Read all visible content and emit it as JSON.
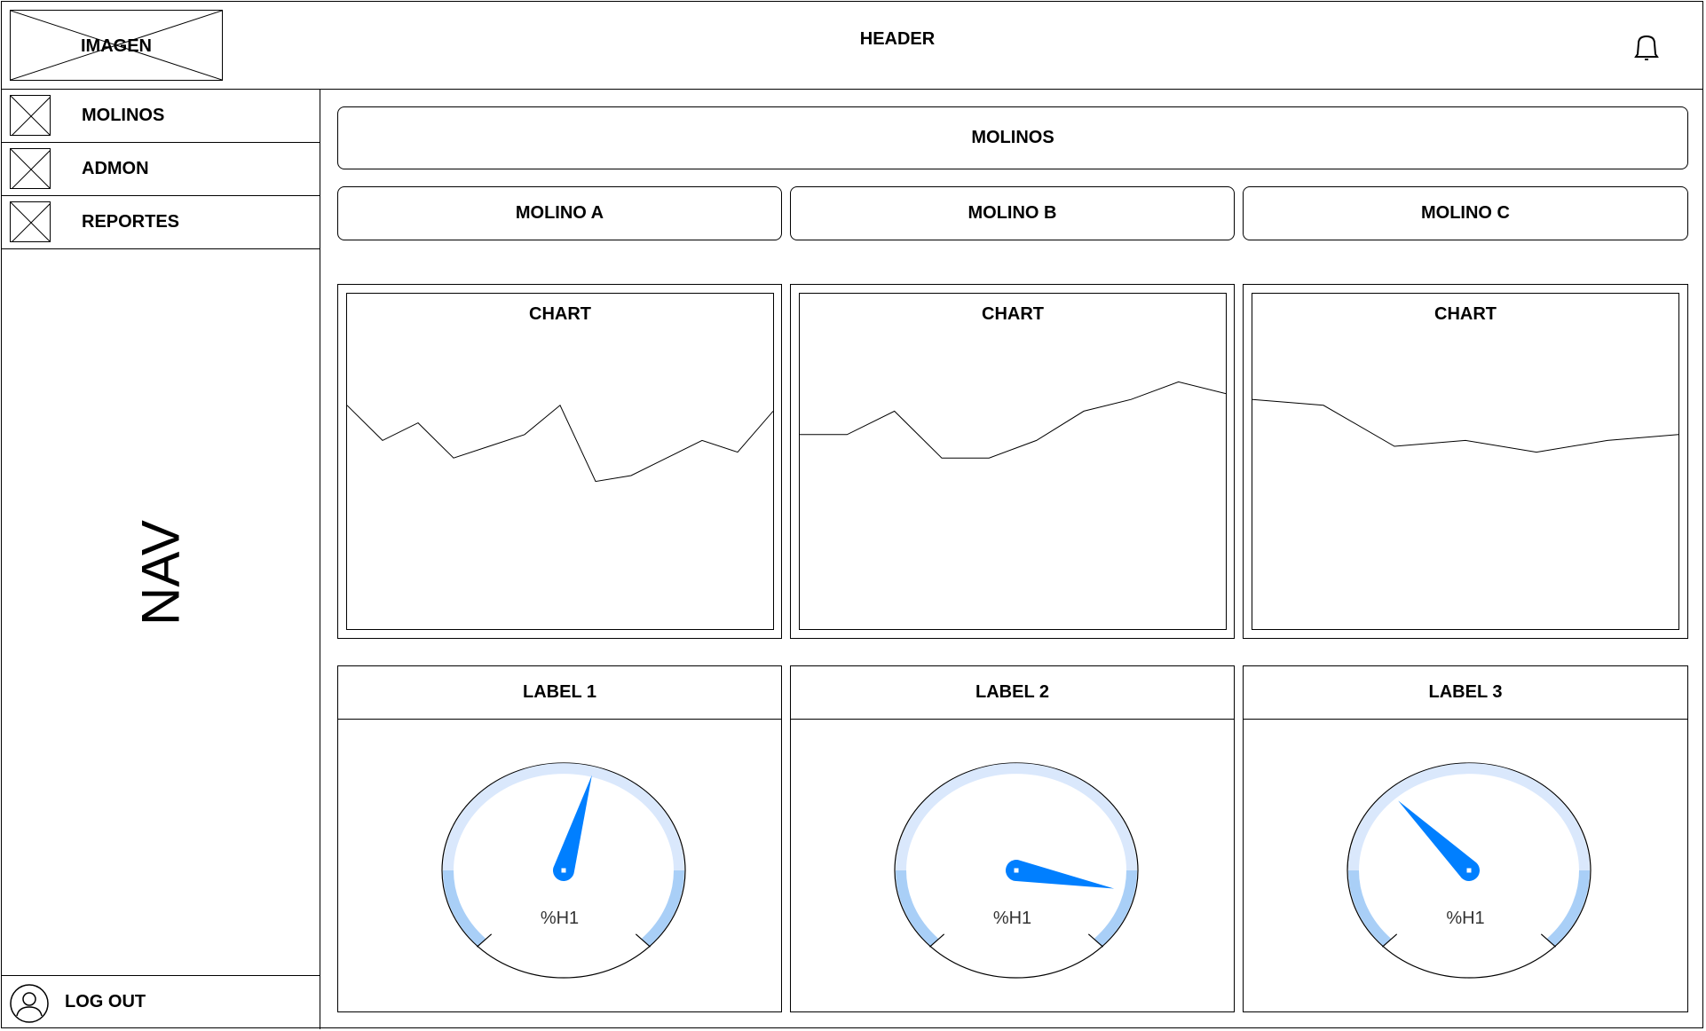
{
  "header": {
    "logo_label": "IMAGEN",
    "title": "HEADER",
    "notification_icon": "bell-icon"
  },
  "nav": {
    "items": [
      {
        "label": "MOLINOS",
        "icon": "image-placeholder-icon"
      },
      {
        "label": "ADMON",
        "icon": "image-placeholder-icon"
      },
      {
        "label": "REPORTES",
        "icon": "image-placeholder-icon"
      }
    ],
    "title": "NAV",
    "logout": {
      "label": "LOG OUT",
      "icon": "user-icon"
    }
  },
  "main": {
    "section_button": "MOLINOS",
    "mill_buttons": [
      "MOLINO A",
      "MOLINO B",
      "MOLINO C"
    ],
    "charts": [
      {
        "title": "CHART",
        "values": [
          57,
          51,
          54,
          48,
          50,
          52,
          57,
          44,
          45,
          48,
          51,
          49,
          56
        ]
      },
      {
        "title": "CHART",
        "values": [
          52,
          52,
          56,
          48,
          48,
          51,
          56,
          58,
          61,
          59
        ]
      },
      {
        "title": "CHART",
        "values": [
          58,
          57,
          50,
          51,
          49,
          51,
          52
        ]
      }
    ],
    "gauges": [
      {
        "label": "LABEL 1",
        "unit": "%H1",
        "needle_deg": 15
      },
      {
        "label": "LABEL 2",
        "unit": "%H1",
        "needle_deg": 99
      },
      {
        "label": "LABEL 3",
        "unit": "%H1",
        "needle_deg": -47
      }
    ]
  },
  "colors": {
    "gauge_needle": "#007FFF",
    "gauge_track": "#DAE8FC",
    "gauge_track_accent": "#A9CFF7",
    "stroke": "#000000"
  }
}
